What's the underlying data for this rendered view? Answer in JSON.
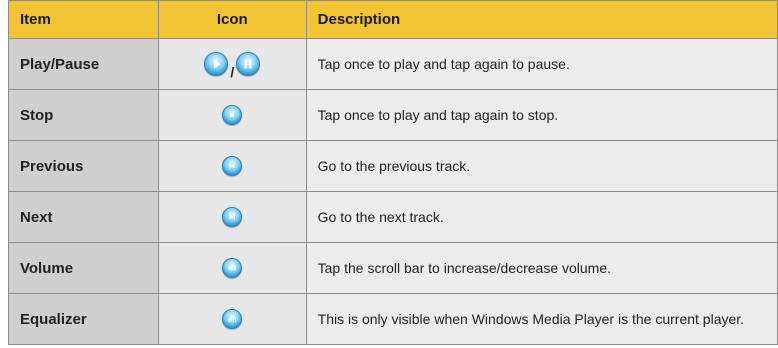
{
  "header": {
    "item": "Item",
    "icon": "Icon",
    "description": "Description"
  },
  "rows": [
    {
      "item": "Play/Pause",
      "icons": [
        "play-icon",
        "pause-icon"
      ],
      "separator": "/",
      "description": "Tap once to play and tap again to pause."
    },
    {
      "item": "Stop",
      "icons": [
        "stop-icon"
      ],
      "description": "Tap once to play and tap again to stop."
    },
    {
      "item": "Previous",
      "icons": [
        "previous-track-icon"
      ],
      "description": "Go to the previous track."
    },
    {
      "item": "Next",
      "icons": [
        "next-track-icon"
      ],
      "description": "Go to the next track."
    },
    {
      "item": "Volume",
      "icons": [
        "volume-icon"
      ],
      "description": "Tap the scroll bar to increase/decrease volume."
    },
    {
      "item": "Equalizer",
      "icons": [
        "equalizer-icon"
      ],
      "description": "This is only visible when Windows Media Player is the current player."
    }
  ],
  "colors": {
    "header_bg": "#f2c433",
    "row_bg": "#dcdcdc",
    "icon_blue": "#1e8fd4"
  }
}
